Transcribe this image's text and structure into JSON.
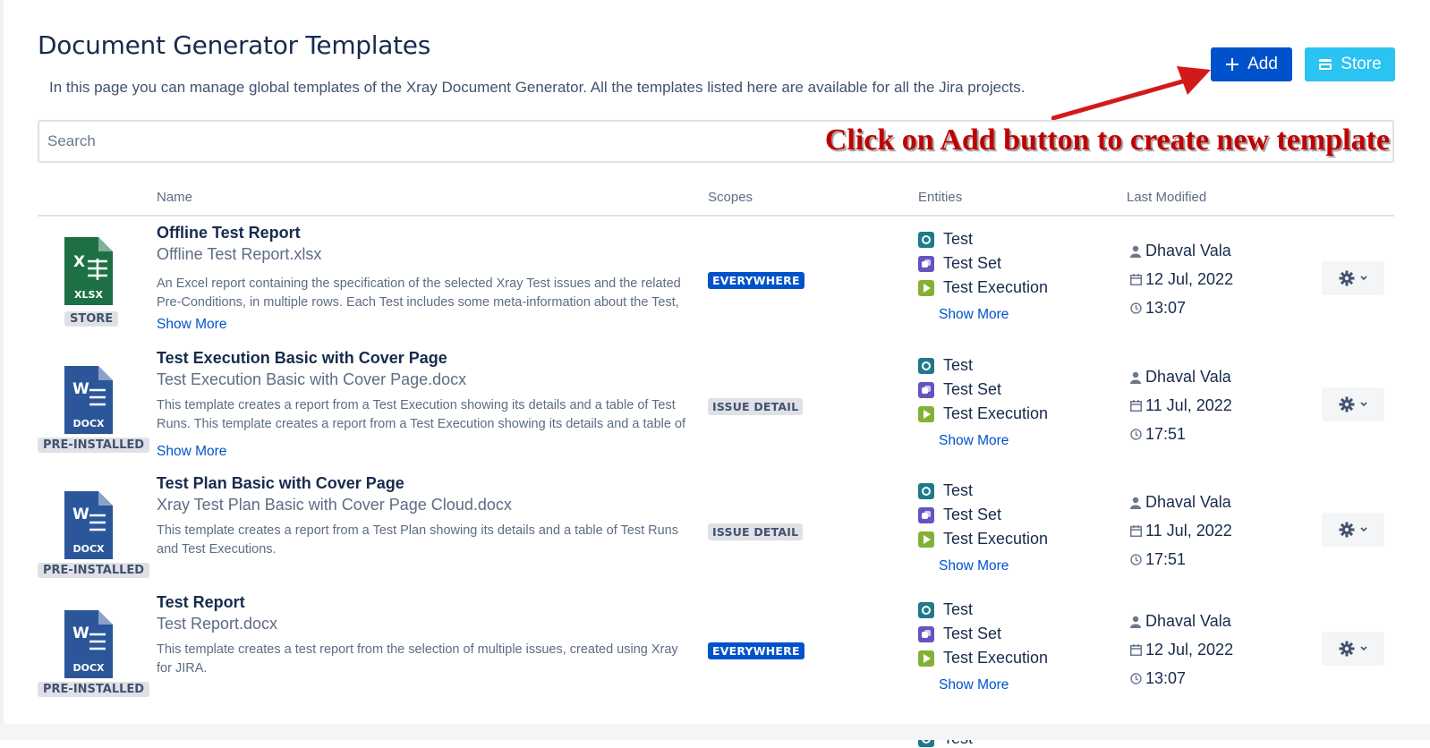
{
  "page": {
    "title": "Document Generator Templates",
    "description": "In this page you can manage global templates of the Xray Document Generator. All the templates listed here are available for all the Jira projects."
  },
  "toolbar": {
    "add_label": "Add",
    "store_label": "Store"
  },
  "search": {
    "placeholder": "Search"
  },
  "annotation": {
    "text": "Click on Add button to create new template",
    "color": "#c00000"
  },
  "table": {
    "headers": {
      "name": "Name",
      "scopes": "Scopes",
      "entities": "Entities",
      "last_modified": "Last Modified"
    }
  },
  "templates": [
    {
      "file_type": "XLSX",
      "file_color": "#1D7044",
      "source_tag": "STORE",
      "name": "Offline Test Report",
      "file": "Offline Test Report.xlsx",
      "description": "An Excel report containing the specification of the selected Xray Test issues and the related Pre-Conditions, in multiple rows. Each Test includes some meta-information about the Test, and also its steps, one per row, together with the Pre-Conditions associated with the Test.",
      "show_more": "Show More",
      "scope": "EVERYWHERE",
      "scope_style": "blue",
      "entities": [
        "Test",
        "Test Set",
        "Test Execution"
      ],
      "entities_more": "Show More",
      "author": "Dhaval Vala",
      "date": "12 Jul, 2022",
      "time": "13:07"
    },
    {
      "file_type": "DOCX",
      "file_color": "#2B579A",
      "source_tag": "PRE-INSTALLED",
      "name": "Test Execution Basic with Cover Page",
      "file": "Test Execution Basic with Cover Page.docx",
      "description": "This template creates a report from a Test Execution showing its details and a table of Test Runs. This template creates a report from a Test Execution showing its details and a table of Test Runs.",
      "show_more": "Show More",
      "scope": "ISSUE DETAIL",
      "scope_style": "grey",
      "entities": [
        "Test",
        "Test Set",
        "Test Execution"
      ],
      "entities_more": "Show More",
      "author": "Dhaval Vala",
      "date": "11 Jul, 2022",
      "time": "17:51"
    },
    {
      "file_type": "DOCX",
      "file_color": "#2B579A",
      "source_tag": "PRE-INSTALLED",
      "name": "Test Plan Basic with Cover Page",
      "file": "Xray Test Plan Basic with Cover Page Cloud.docx",
      "description": "This template creates a report from a Test Plan showing its details and a table of Test Runs and Test Executions.",
      "show_more": "",
      "scope": "ISSUE DETAIL",
      "scope_style": "grey",
      "entities": [
        "Test",
        "Test Set",
        "Test Execution"
      ],
      "entities_more": "Show More",
      "author": "Dhaval Vala",
      "date": "11 Jul, 2022",
      "time": "17:51"
    },
    {
      "file_type": "DOCX",
      "file_color": "#2B579A",
      "source_tag": "PRE-INSTALLED",
      "name": "Test Report",
      "file": "Test Report.docx",
      "description": "This template creates a test report from the selection of multiple issues, created using Xray for JIRA.",
      "show_more": "",
      "scope": "EVERYWHERE",
      "scope_style": "blue",
      "entities": [
        "Test",
        "Test Set",
        "Test Execution"
      ],
      "entities_more": "Show More",
      "author": "Dhaval Vala",
      "date": "12 Jul, 2022",
      "time": "13:07"
    }
  ],
  "partial_row": {
    "entity": "Test"
  }
}
